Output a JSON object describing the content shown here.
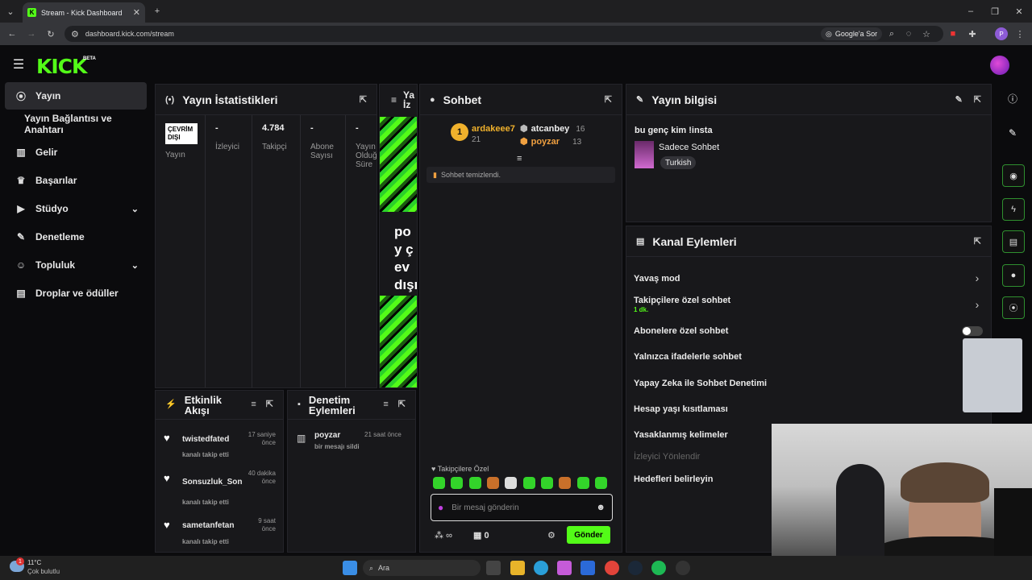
{
  "browser": {
    "tab_title": "Stream - Kick Dashboard",
    "url": "dashboard.kick.com/stream",
    "google_label": "Google'a Sor"
  },
  "brand": {
    "logo": "KICK",
    "beta": "BETA",
    "accent": "#53fc18"
  },
  "sidebar": {
    "items": [
      {
        "label": "Yayın",
        "icon": "broadcast-icon"
      },
      {
        "label": "Yayın Bağlantısı ve Anahtarı"
      },
      {
        "label": "Gelir",
        "icon": "chart-icon"
      },
      {
        "label": "Başarılar",
        "icon": "trophy-icon"
      },
      {
        "label": "Stüdyo",
        "icon": "video-icon"
      },
      {
        "label": "Denetleme",
        "icon": "wrench-icon"
      },
      {
        "label": "Topluluk",
        "icon": "people-icon"
      },
      {
        "label": "Droplar ve ödüller",
        "icon": "gift-icon"
      }
    ]
  },
  "stats": {
    "title": "Yayın İstatistikleri",
    "badge": "ÇEVRİM DIŞI",
    "cols": [
      {
        "value": "",
        "label": "Yayın"
      },
      {
        "value": "-",
        "label": "İzleyici"
      },
      {
        "value": "4.784",
        "label": "Takipçi"
      },
      {
        "value": "-",
        "label": "Abone Sayısı"
      },
      {
        "value": "-",
        "label": "Yayın Olduğ Süre"
      }
    ]
  },
  "preview": {
    "header": "Ya İz",
    "text": "poy çev dışı"
  },
  "chat": {
    "title": "Sohbet",
    "top": [
      {
        "rank": "1",
        "name": "ardakeee7",
        "count": "21"
      },
      {
        "name": "atcanbey",
        "count": "16"
      },
      {
        "name": "poyzar",
        "count": "13"
      }
    ],
    "cleared": "Sohbet temizlendi.",
    "emote_label": "Takipçilere Özel",
    "placeholder": "Bir mesaj gönderin",
    "infinity": "∞",
    "points": "0",
    "send": "Gönder"
  },
  "info": {
    "title": "Yayın bilgisi",
    "stream_title": "bu genç kim !insta",
    "category": "Sadece Sohbet",
    "language": "Turkish"
  },
  "channel": {
    "title": "Kanal Eylemleri",
    "items": [
      {
        "label": "Yavaş mod"
      },
      {
        "label": "Takipçilere özel sohbet",
        "sub": "1 dk."
      },
      {
        "label": "Abonelere özel sohbet"
      },
      {
        "label": "Yalnızca ifadelerle sohbet"
      },
      {
        "label": "Yapay Zeka ile Sohbet Denetimi"
      },
      {
        "label": "Hesap yaşı kısıtlaması"
      },
      {
        "label": "Yasaklanmış kelimeler"
      },
      {
        "label": "İzleyici Yönlendir"
      },
      {
        "label": "Hedefleri belirleyin"
      }
    ]
  },
  "activity": {
    "title": "Etkinlik Akışı",
    "items": [
      {
        "name": "twistedfated",
        "time": "17 saniye önce",
        "desc": "kanalı takip etti"
      },
      {
        "name": "Sonsuzluk_Son",
        "time": "40 dakika önce",
        "desc": "kanalı takip etti"
      },
      {
        "name": "sametanfetan",
        "time": "9 saat önce",
        "desc": "kanalı takip etti"
      }
    ]
  },
  "mod": {
    "title": "Denetim Eylemleri",
    "items": [
      {
        "name": "poyzar",
        "time": "21 saat önce",
        "desc": "bir mesajı sildi"
      }
    ]
  },
  "taskbar": {
    "temp": "11°C",
    "weather": "Çok bulutlu",
    "search": "Ara",
    "notif": "1"
  }
}
